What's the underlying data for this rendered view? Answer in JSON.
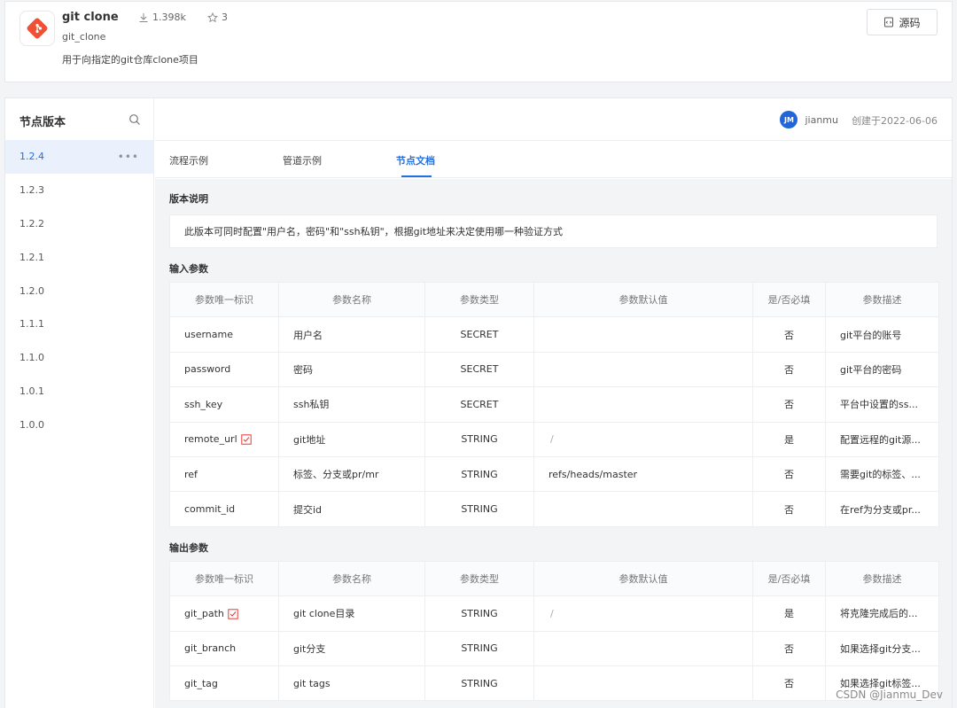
{
  "plugin": {
    "title": "git clone",
    "name": "git_clone",
    "downloads": "1.398k",
    "stars": "3",
    "description": "用于向指定的git仓库clone项目",
    "source_label": "源码"
  },
  "sidebar": {
    "title": "节点版本",
    "versions": [
      "1.2.4",
      "1.2.3",
      "1.2.2",
      "1.2.1",
      "1.2.0",
      "1.1.1",
      "1.1.0",
      "1.0.1",
      "1.0.0"
    ],
    "active": "1.2.4",
    "more": "•••"
  },
  "topbar": {
    "author_initials": "JM",
    "author": "jianmu",
    "created": "创建于2022-06-06"
  },
  "tabs": [
    "流程示例",
    "管道示例",
    "节点文档"
  ],
  "active_tab": "节点文档",
  "version_section": {
    "title": "版本说明",
    "text": "此版本可同时配置\"用户名，密码\"和\"ssh私钥\"，根据git地址来决定使用哪一种验证方式"
  },
  "input_section": {
    "title": "输入参数",
    "headers": [
      "参数唯一标识",
      "参数名称",
      "参数类型",
      "参数默认值",
      "是/否必填",
      "参数描述"
    ],
    "rows": [
      {
        "id": "username",
        "name": "用户名",
        "type": "SECRET",
        "default": "",
        "required": "否",
        "desc": "git平台的账号",
        "flag": false
      },
      {
        "id": "password",
        "name": "密码",
        "type": "SECRET",
        "default": "",
        "required": "否",
        "desc": "git平台的密码",
        "flag": false
      },
      {
        "id": "ssh_key",
        "name": "ssh私钥",
        "type": "SECRET",
        "default": "",
        "required": "否",
        "desc": "平台中设置的ss...",
        "flag": false
      },
      {
        "id": "remote_url",
        "name": "git地址",
        "type": "STRING",
        "default": "/",
        "required": "是",
        "desc": "配置远程的git源...",
        "flag": true
      },
      {
        "id": "ref",
        "name": "标签、分支或pr/mr",
        "type": "STRING",
        "default": "refs/heads/master",
        "required": "否",
        "desc": "需要git的标签、...",
        "flag": false
      },
      {
        "id": "commit_id",
        "name": "提交id",
        "type": "STRING",
        "default": "",
        "required": "否",
        "desc": "在ref为分支或pr...",
        "flag": false
      }
    ]
  },
  "output_section": {
    "title": "输出参数",
    "headers": [
      "参数唯一标识",
      "参数名称",
      "参数类型",
      "参数默认值",
      "是/否必填",
      "参数描述"
    ],
    "rows": [
      {
        "id": "git_path",
        "name": "git clone目录",
        "type": "STRING",
        "default": "/",
        "required": "是",
        "desc": "将克隆完成后的...",
        "flag": true
      },
      {
        "id": "git_branch",
        "name": "git分支",
        "type": "STRING",
        "default": "",
        "required": "否",
        "desc": "如果选择git分支...",
        "flag": false
      },
      {
        "id": "git_tag",
        "name": "git tags",
        "type": "STRING",
        "default": "",
        "required": "否",
        "desc": "如果选择git标签...",
        "flag": false
      }
    ]
  },
  "watermark": "CSDN @Jianmu_Dev",
  "colors": {
    "accent": "#2470e0",
    "required": "#e53935",
    "logo": "#f05033"
  }
}
